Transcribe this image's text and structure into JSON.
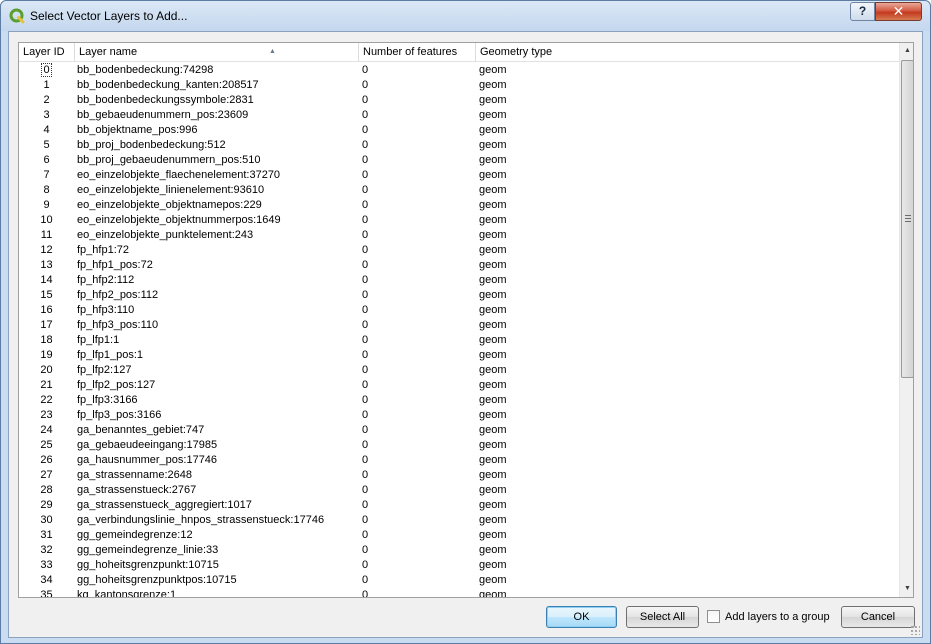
{
  "window": {
    "title": "Select Vector Layers to Add...",
    "help_label": "?",
    "close_label": "✕"
  },
  "table": {
    "columns": [
      "Layer ID",
      "Layer name",
      "Number of features",
      "Geometry type"
    ],
    "sort_column": "Layer name",
    "rows": [
      {
        "id": "0",
        "name": "bb_bodenbedeckung:74298",
        "features": "0",
        "geom": "geom"
      },
      {
        "id": "1",
        "name": "bb_bodenbedeckung_kanten:208517",
        "features": "0",
        "geom": "geom"
      },
      {
        "id": "2",
        "name": "bb_bodenbedeckungssymbole:2831",
        "features": "0",
        "geom": "geom"
      },
      {
        "id": "3",
        "name": "bb_gebaeudenummern_pos:23609",
        "features": "0",
        "geom": "geom"
      },
      {
        "id": "4",
        "name": "bb_objektname_pos:996",
        "features": "0",
        "geom": "geom"
      },
      {
        "id": "5",
        "name": "bb_proj_bodenbedeckung:512",
        "features": "0",
        "geom": "geom"
      },
      {
        "id": "6",
        "name": "bb_proj_gebaeudenummern_pos:510",
        "features": "0",
        "geom": "geom"
      },
      {
        "id": "7",
        "name": "eo_einzelobjekte_flaechenelement:37270",
        "features": "0",
        "geom": "geom"
      },
      {
        "id": "8",
        "name": "eo_einzelobjekte_linienelement:93610",
        "features": "0",
        "geom": "geom"
      },
      {
        "id": "9",
        "name": "eo_einzelobjekte_objektnamepos:229",
        "features": "0",
        "geom": "geom"
      },
      {
        "id": "10",
        "name": "eo_einzelobjekte_objektnummerpos:1649",
        "features": "0",
        "geom": "geom"
      },
      {
        "id": "11",
        "name": "eo_einzelobjekte_punktelement:243",
        "features": "0",
        "geom": "geom"
      },
      {
        "id": "12",
        "name": "fp_hfp1:72",
        "features": "0",
        "geom": "geom"
      },
      {
        "id": "13",
        "name": "fp_hfp1_pos:72",
        "features": "0",
        "geom": "geom"
      },
      {
        "id": "14",
        "name": "fp_hfp2:112",
        "features": "0",
        "geom": "geom"
      },
      {
        "id": "15",
        "name": "fp_hfp2_pos:112",
        "features": "0",
        "geom": "geom"
      },
      {
        "id": "16",
        "name": "fp_hfp3:110",
        "features": "0",
        "geom": "geom"
      },
      {
        "id": "17",
        "name": "fp_hfp3_pos:110",
        "features": "0",
        "geom": "geom"
      },
      {
        "id": "18",
        "name": "fp_lfp1:1",
        "features": "0",
        "geom": "geom"
      },
      {
        "id": "19",
        "name": "fp_lfp1_pos:1",
        "features": "0",
        "geom": "geom"
      },
      {
        "id": "20",
        "name": "fp_lfp2:127",
        "features": "0",
        "geom": "geom"
      },
      {
        "id": "21",
        "name": "fp_lfp2_pos:127",
        "features": "0",
        "geom": "geom"
      },
      {
        "id": "22",
        "name": "fp_lfp3:3166",
        "features": "0",
        "geom": "geom"
      },
      {
        "id": "23",
        "name": "fp_lfp3_pos:3166",
        "features": "0",
        "geom": "geom"
      },
      {
        "id": "24",
        "name": "ga_benanntes_gebiet:747",
        "features": "0",
        "geom": "geom"
      },
      {
        "id": "25",
        "name": "ga_gebaeudeeingang:17985",
        "features": "0",
        "geom": "geom"
      },
      {
        "id": "26",
        "name": "ga_hausnummer_pos:17746",
        "features": "0",
        "geom": "geom"
      },
      {
        "id": "27",
        "name": "ga_strassenname:2648",
        "features": "0",
        "geom": "geom"
      },
      {
        "id": "28",
        "name": "ga_strassenstueck:2767",
        "features": "0",
        "geom": "geom"
      },
      {
        "id": "29",
        "name": "ga_strassenstueck_aggregiert:1017",
        "features": "0",
        "geom": "geom"
      },
      {
        "id": "30",
        "name": "ga_verbindungslinie_hnpos_strassenstueck:17746",
        "features": "0",
        "geom": "geom"
      },
      {
        "id": "31",
        "name": "gg_gemeindegrenze:12",
        "features": "0",
        "geom": "geom"
      },
      {
        "id": "32",
        "name": "gg_gemeindegrenze_linie:33",
        "features": "0",
        "geom": "geom"
      },
      {
        "id": "33",
        "name": "gg_hoheitsgrenzpunkt:10715",
        "features": "0",
        "geom": "geom"
      },
      {
        "id": "34",
        "name": "gg_hoheitsgrenzpunktpos:10715",
        "features": "0",
        "geom": "geom"
      },
      {
        "id": "35",
        "name": "kg_kantonsgrenze:1",
        "features": "0",
        "geom": "geom"
      }
    ]
  },
  "footer": {
    "ok_label": "OK",
    "select_all_label": "Select All",
    "add_to_group_label": "Add layers to a group",
    "add_to_group_checked": false,
    "cancel_label": "Cancel"
  },
  "colors": {
    "title_bar": "#c4d7ee",
    "close_button": "#c3391f",
    "default_button_border": "#3c7fb1",
    "dialog_background": "#f0f0f0"
  },
  "icons": {
    "app": "qgis-logo-icon",
    "sort": "sort-ascending-icon"
  }
}
